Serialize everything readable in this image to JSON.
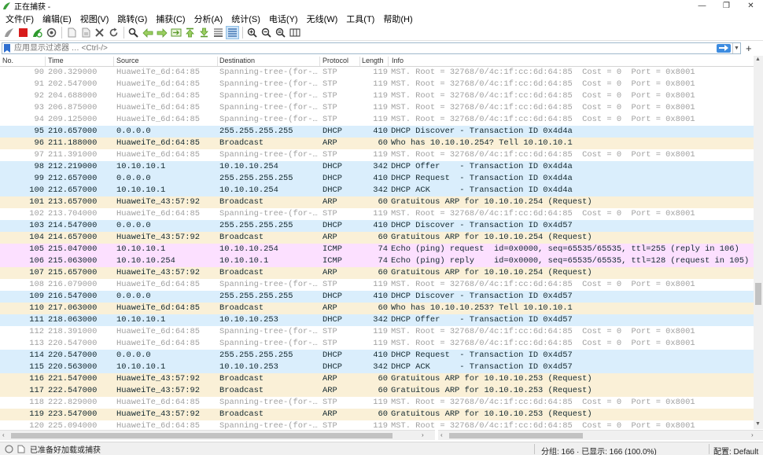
{
  "window": {
    "title": "正在捕获 -",
    "minimize": "—",
    "maximize": "❐",
    "close": "✕"
  },
  "menu": [
    "文件(F)",
    "编辑(E)",
    "视图(V)",
    "跳转(G)",
    "捕获(C)",
    "分析(A)",
    "统计(S)",
    "电话(Y)",
    "无线(W)",
    "工具(T)",
    "帮助(H)"
  ],
  "toolbar_icons": [
    "shark-fin-start-icon",
    "stop-capture-icon",
    "restart-capture-icon",
    "capture-options-icon",
    "open-file-icon",
    "save-file-icon",
    "close-file-icon",
    "reload-file-icon",
    "find-packet-icon",
    "go-back-icon",
    "go-forward-icon",
    "go-to-packet-icon",
    "first-packet-icon",
    "last-packet-icon",
    "auto-scroll-icon",
    "colorize-icon",
    "zoom-in-icon",
    "zoom-out-icon",
    "zoom-normal-icon",
    "resize-columns-icon"
  ],
  "filter": {
    "placeholder": "应用显示过滤器 … <Ctrl-/>"
  },
  "columns": {
    "no": "No.",
    "time": "Time",
    "source": "Source",
    "destination": "Destination",
    "protocol": "Protocol",
    "length": "Length",
    "info": "Info"
  },
  "colors": {
    "stp_text": "#a0a0a0",
    "dhcp_bg": "#daeefc",
    "arp_bg": "#faf0d7",
    "icmp_bg": "#fce0ff"
  },
  "packets": [
    {
      "no": "90",
      "time": "200.329000",
      "src": "HuaweiTe_6d:64:85",
      "dst": "Spanning-tree-(for-…",
      "proto": "STP",
      "len": "119",
      "info": "MST. Root = 32768/0/4c:1f:cc:6d:64:85  Cost = 0  Port = 0x8001",
      "cls": "stp"
    },
    {
      "no": "91",
      "time": "202.547000",
      "src": "HuaweiTe_6d:64:85",
      "dst": "Spanning-tree-(for-…",
      "proto": "STP",
      "len": "119",
      "info": "MST. Root = 32768/0/4c:1f:cc:6d:64:85  Cost = 0  Port = 0x8001",
      "cls": "stp"
    },
    {
      "no": "92",
      "time": "204.688000",
      "src": "HuaweiTe_6d:64:85",
      "dst": "Spanning-tree-(for-…",
      "proto": "STP",
      "len": "119",
      "info": "MST. Root = 32768/0/4c:1f:cc:6d:64:85  Cost = 0  Port = 0x8001",
      "cls": "stp"
    },
    {
      "no": "93",
      "time": "206.875000",
      "src": "HuaweiTe_6d:64:85",
      "dst": "Spanning-tree-(for-…",
      "proto": "STP",
      "len": "119",
      "info": "MST. Root = 32768/0/4c:1f:cc:6d:64:85  Cost = 0  Port = 0x8001",
      "cls": "stp"
    },
    {
      "no": "94",
      "time": "209.125000",
      "src": "HuaweiTe_6d:64:85",
      "dst": "Spanning-tree-(for-…",
      "proto": "STP",
      "len": "119",
      "info": "MST. Root = 32768/0/4c:1f:cc:6d:64:85  Cost = 0  Port = 0x8001",
      "cls": "stp"
    },
    {
      "no": "95",
      "time": "210.657000",
      "src": "0.0.0.0",
      "dst": "255.255.255.255",
      "proto": "DHCP",
      "len": "410",
      "info": "DHCP Discover - Transaction ID 0x4d4a",
      "cls": "dhcp"
    },
    {
      "no": "96",
      "time": "211.188000",
      "src": "HuaweiTe_6d:64:85",
      "dst": "Broadcast",
      "proto": "ARP",
      "len": "60",
      "info": "Who has 10.10.10.254? Tell 10.10.10.1",
      "cls": "arp"
    },
    {
      "no": "97",
      "time": "211.391000",
      "src": "HuaweiTe_6d:64:85",
      "dst": "Spanning-tree-(for-…",
      "proto": "STP",
      "len": "119",
      "info": "MST. Root = 32768/0/4c:1f:cc:6d:64:85  Cost = 0  Port = 0x8001",
      "cls": "stp"
    },
    {
      "no": "98",
      "time": "212.219000",
      "src": "10.10.10.1",
      "dst": "10.10.10.254",
      "proto": "DHCP",
      "len": "342",
      "info": "DHCP Offer    - Transaction ID 0x4d4a",
      "cls": "dhcp"
    },
    {
      "no": "99",
      "time": "212.657000",
      "src": "0.0.0.0",
      "dst": "255.255.255.255",
      "proto": "DHCP",
      "len": "410",
      "info": "DHCP Request  - Transaction ID 0x4d4a",
      "cls": "dhcp"
    },
    {
      "no": "100",
      "time": "212.657000",
      "src": "10.10.10.1",
      "dst": "10.10.10.254",
      "proto": "DHCP",
      "len": "342",
      "info": "DHCP ACK      - Transaction ID 0x4d4a",
      "cls": "dhcp"
    },
    {
      "no": "101",
      "time": "213.657000",
      "src": "HuaweiTe_43:57:92",
      "dst": "Broadcast",
      "proto": "ARP",
      "len": "60",
      "info": "Gratuitous ARP for 10.10.10.254 (Request)",
      "cls": "arp"
    },
    {
      "no": "102",
      "time": "213.704000",
      "src": "HuaweiTe_6d:64:85",
      "dst": "Spanning-tree-(for-…",
      "proto": "STP",
      "len": "119",
      "info": "MST. Root = 32768/0/4c:1f:cc:6d:64:85  Cost = 0  Port = 0x8001",
      "cls": "stp"
    },
    {
      "no": "103",
      "time": "214.547000",
      "src": "0.0.0.0",
      "dst": "255.255.255.255",
      "proto": "DHCP",
      "len": "410",
      "info": "DHCP Discover - Transaction ID 0x4d57",
      "cls": "dhcp"
    },
    {
      "no": "104",
      "time": "214.657000",
      "src": "HuaweiTe_43:57:92",
      "dst": "Broadcast",
      "proto": "ARP",
      "len": "60",
      "info": "Gratuitous ARP for 10.10.10.254 (Request)",
      "cls": "arp"
    },
    {
      "no": "105",
      "time": "215.047000",
      "src": "10.10.10.1",
      "dst": "10.10.10.254",
      "proto": "ICMP",
      "len": "74",
      "info": "Echo (ping) request  id=0x0000, seq=65535/65535, ttl=255 (reply in 106)",
      "cls": "icmp"
    },
    {
      "no": "106",
      "time": "215.063000",
      "src": "10.10.10.254",
      "dst": "10.10.10.1",
      "proto": "ICMP",
      "len": "74",
      "info": "Echo (ping) reply    id=0x0000, seq=65535/65535, ttl=128 (request in 105)",
      "cls": "icmp"
    },
    {
      "no": "107",
      "time": "215.657000",
      "src": "HuaweiTe_43:57:92",
      "dst": "Broadcast",
      "proto": "ARP",
      "len": "60",
      "info": "Gratuitous ARP for 10.10.10.254 (Request)",
      "cls": "arp"
    },
    {
      "no": "108",
      "time": "216.079000",
      "src": "HuaweiTe_6d:64:85",
      "dst": "Spanning-tree-(for-…",
      "proto": "STP",
      "len": "119",
      "info": "MST. Root = 32768/0/4c:1f:cc:6d:64:85  Cost = 0  Port = 0x8001",
      "cls": "stp"
    },
    {
      "no": "109",
      "time": "216.547000",
      "src": "0.0.0.0",
      "dst": "255.255.255.255",
      "proto": "DHCP",
      "len": "410",
      "info": "DHCP Discover - Transaction ID 0x4d57",
      "cls": "dhcp"
    },
    {
      "no": "110",
      "time": "217.063000",
      "src": "HuaweiTe_6d:64:85",
      "dst": "Broadcast",
      "proto": "ARP",
      "len": "60",
      "info": "Who has 10.10.10.253? Tell 10.10.10.1",
      "cls": "arp"
    },
    {
      "no": "111",
      "time": "218.063000",
      "src": "10.10.10.1",
      "dst": "10.10.10.253",
      "proto": "DHCP",
      "len": "342",
      "info": "DHCP Offer    - Transaction ID 0x4d57",
      "cls": "dhcp"
    },
    {
      "no": "112",
      "time": "218.391000",
      "src": "HuaweiTe_6d:64:85",
      "dst": "Spanning-tree-(for-…",
      "proto": "STP",
      "len": "119",
      "info": "MST. Root = 32768/0/4c:1f:cc:6d:64:85  Cost = 0  Port = 0x8001",
      "cls": "stp"
    },
    {
      "no": "113",
      "time": "220.547000",
      "src": "HuaweiTe_6d:64:85",
      "dst": "Spanning-tree-(for-…",
      "proto": "STP",
      "len": "119",
      "info": "MST. Root = 32768/0/4c:1f:cc:6d:64:85  Cost = 0  Port = 0x8001",
      "cls": "stp"
    },
    {
      "no": "114",
      "time": "220.547000",
      "src": "0.0.0.0",
      "dst": "255.255.255.255",
      "proto": "DHCP",
      "len": "410",
      "info": "DHCP Request  - Transaction ID 0x4d57",
      "cls": "dhcp"
    },
    {
      "no": "115",
      "time": "220.563000",
      "src": "10.10.10.1",
      "dst": "10.10.10.253",
      "proto": "DHCP",
      "len": "342",
      "info": "DHCP ACK      - Transaction ID 0x4d57",
      "cls": "dhcp"
    },
    {
      "no": "116",
      "time": "221.547000",
      "src": "HuaweiTe_43:57:92",
      "dst": "Broadcast",
      "proto": "ARP",
      "len": "60",
      "info": "Gratuitous ARP for 10.10.10.253 (Request)",
      "cls": "arp"
    },
    {
      "no": "117",
      "time": "222.547000",
      "src": "HuaweiTe_43:57:92",
      "dst": "Broadcast",
      "proto": "ARP",
      "len": "60",
      "info": "Gratuitous ARP for 10.10.10.253 (Request)",
      "cls": "arp"
    },
    {
      "no": "118",
      "time": "222.829000",
      "src": "HuaweiTe_6d:64:85",
      "dst": "Spanning-tree-(for-…",
      "proto": "STP",
      "len": "119",
      "info": "MST. Root = 32768/0/4c:1f:cc:6d:64:85  Cost = 0  Port = 0x8001",
      "cls": "stp"
    },
    {
      "no": "119",
      "time": "223.547000",
      "src": "HuaweiTe_43:57:92",
      "dst": "Broadcast",
      "proto": "ARP",
      "len": "60",
      "info": "Gratuitous ARP for 10.10.10.253 (Request)",
      "cls": "arp"
    },
    {
      "no": "120",
      "time": "225.094000",
      "src": "HuaweiTe_6d:64:85",
      "dst": "Spanning-tree-(for-…",
      "proto": "STP",
      "len": "119",
      "info": "MST. Root = 32768/0/4c:1f:cc:6d:64:85  Cost = 0  Port = 0x8001",
      "cls": "stp"
    }
  ],
  "status": {
    "ready": "已准备好加载或捕获",
    "packets": "分组: 166 · 已显示: 166 (100.0%)",
    "profile": "配置: Default"
  }
}
